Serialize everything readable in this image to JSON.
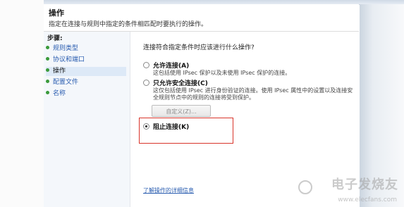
{
  "header": {
    "title": "操作",
    "description": "指定在连接与规则中指定的条件相匹配时要执行的操作。"
  },
  "sidebar": {
    "steps_title": "步骤:",
    "steps": [
      {
        "label": "规则类型",
        "active": false
      },
      {
        "label": "协议和端口",
        "active": false
      },
      {
        "label": "操作",
        "active": true
      },
      {
        "label": "配置文件",
        "active": false
      },
      {
        "label": "名称",
        "active": false
      }
    ]
  },
  "main": {
    "question": "连接符合指定条件时应该进行什么操作?",
    "options": [
      {
        "label": "允许连接(A)",
        "description": [
          "这包括使用 IPsec 保护以及未使用 IPsec 保护的连接。"
        ],
        "checked": false
      },
      {
        "label": "只允许安全连接(C)",
        "description": [
          "这仅包括使用 IPsec 进行身份验证的连接。使用 IPsec 属性中的设置以及连接安",
          "全规则节点中的规则的连接将受到保护。"
        ],
        "checked": false
      },
      {
        "label": "阻止连接(K)",
        "description": [],
        "checked": true
      }
    ],
    "customize_button": "自定义(Z)...",
    "learn_more_link": "了解操作的详细信息"
  },
  "watermark": {
    "text": "电子发烧友",
    "url": "www.elecfans.com"
  },
  "colors": {
    "highlight_border": "#d9342b",
    "link": "#2a5db0",
    "step_bullet": "#3a9a3a"
  }
}
